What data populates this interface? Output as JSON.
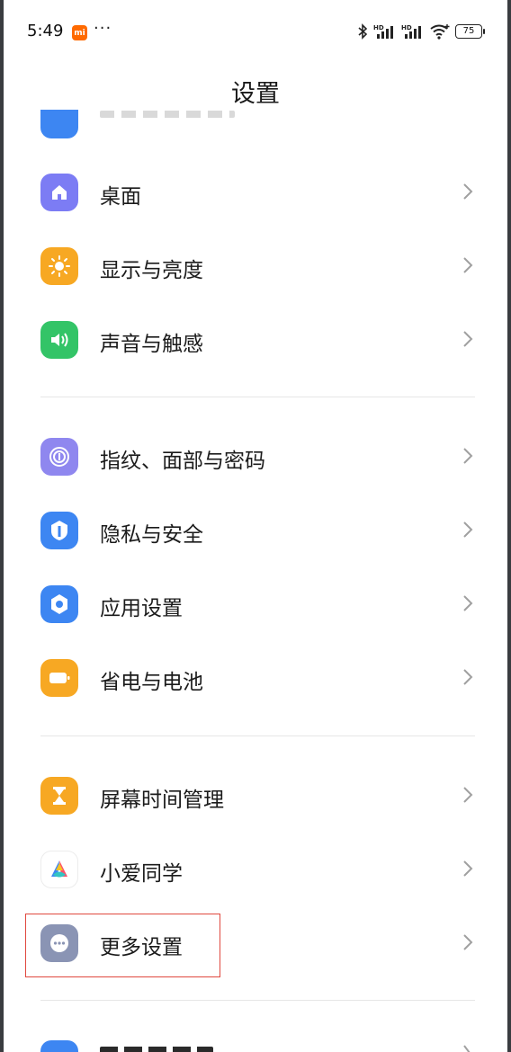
{
  "status_bar": {
    "time": "5:49",
    "mi_badge": "mi",
    "more": "···",
    "battery": "75",
    "icons": [
      "bluetooth-icon",
      "hd-signal-icon",
      "hd-signal-icon",
      "wifi-icon",
      "battery-icon"
    ]
  },
  "header": {
    "title": "设置"
  },
  "groups": [
    {
      "items": [
        {
          "label": "桌面",
          "icon": "home-icon",
          "color": "#7c7cf4"
        },
        {
          "label": "显示与亮度",
          "icon": "sun-icon",
          "color": "#f7a823"
        },
        {
          "label": "声音与触感",
          "icon": "speaker-icon",
          "color": "#33c467"
        }
      ]
    },
    {
      "items": [
        {
          "label": "指纹、面部与密码",
          "icon": "fingerprint-icon",
          "color": "#8f87ef"
        },
        {
          "label": "隐私与安全",
          "icon": "shield-icon",
          "color": "#3d86f2"
        },
        {
          "label": "应用设置",
          "icon": "gear-icon",
          "color": "#3d86f2"
        },
        {
          "label": "省电与电池",
          "icon": "battery-icon",
          "color": "#f7a823"
        }
      ]
    },
    {
      "items": [
        {
          "label": "屏幕时间管理",
          "icon": "hourglass-icon",
          "color": "#f7a823"
        },
        {
          "label": "小爱同学",
          "icon": "xiaoai-icon",
          "color": "#ffffff"
        },
        {
          "label": "更多设置",
          "icon": "more-icon",
          "color": "#8a94b4"
        }
      ]
    }
  ]
}
